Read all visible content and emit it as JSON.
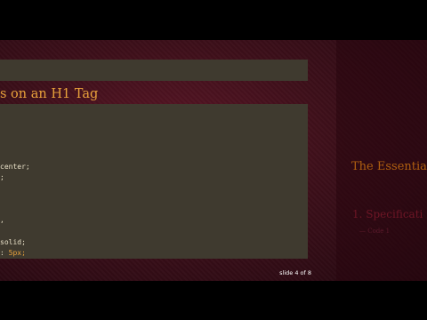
{
  "slide": {
    "title": "s on an H1 Tag",
    "code_lines": [
      {
        "text": "center;",
        "num": ""
      },
      {
        "text": ";",
        "num": ""
      },
      {
        "text": ",",
        "num": ""
      },
      {
        "text": "solid;",
        "num": ""
      },
      {
        "text": ": ",
        "num": "5px;"
      }
    ],
    "slide_number": "slide 4 of 8"
  },
  "sidebar": {
    "heading": "",
    "items": [
      "",
      "",
      "",
      "",
      "",
      ""
    ],
    "section_title": "The Essentia",
    "paragraph": "",
    "spec_title": "1. Specificati",
    "sub_item": "— Code 1"
  }
}
